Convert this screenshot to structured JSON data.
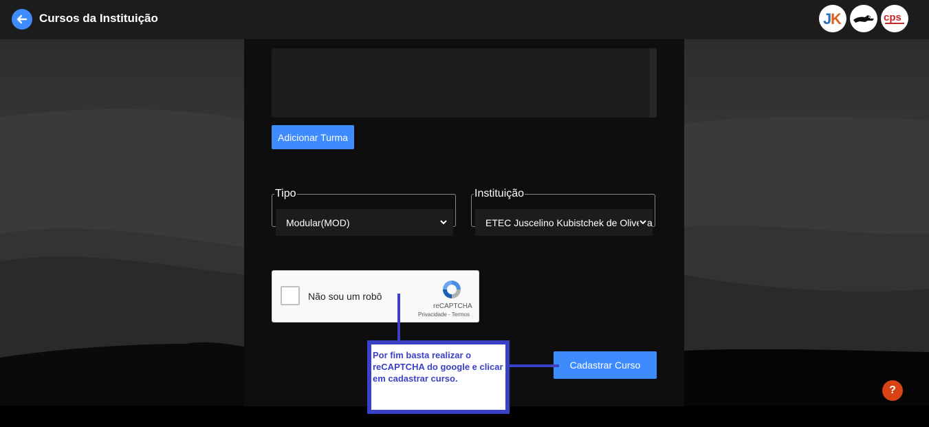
{
  "header": {
    "title": "Cursos da Instituição",
    "back_icon": "arrow-left-icon",
    "logos": [
      {
        "name": "jk-logo",
        "text": "JK"
      },
      {
        "name": "mustang-logo",
        "text": ""
      },
      {
        "name": "cps-logo",
        "text": "cps"
      }
    ]
  },
  "form": {
    "add_turma_label": "Adicionar Turma",
    "tipo": {
      "legend": "Tipo",
      "selected": "Modular(MOD)"
    },
    "instituicao": {
      "legend": "Instituição",
      "selected": "ETEC Juscelino Kubistchek de Oliveira"
    },
    "captcha": {
      "label": "Não sou um robô",
      "brand": "reCAPTCHA",
      "privacy": "Privacidade",
      "separator": " - ",
      "terms": "Termos"
    },
    "submit_label": "Cadastrar Curso"
  },
  "annotation": {
    "text": "Por fim basta realizar o reCAPTCHA do google e clicar em cadastrar curso."
  },
  "help": {
    "label": "?"
  },
  "colors": {
    "accent": "#3d8bfd",
    "annotation": "#3b41c5",
    "help": "#d84315"
  }
}
